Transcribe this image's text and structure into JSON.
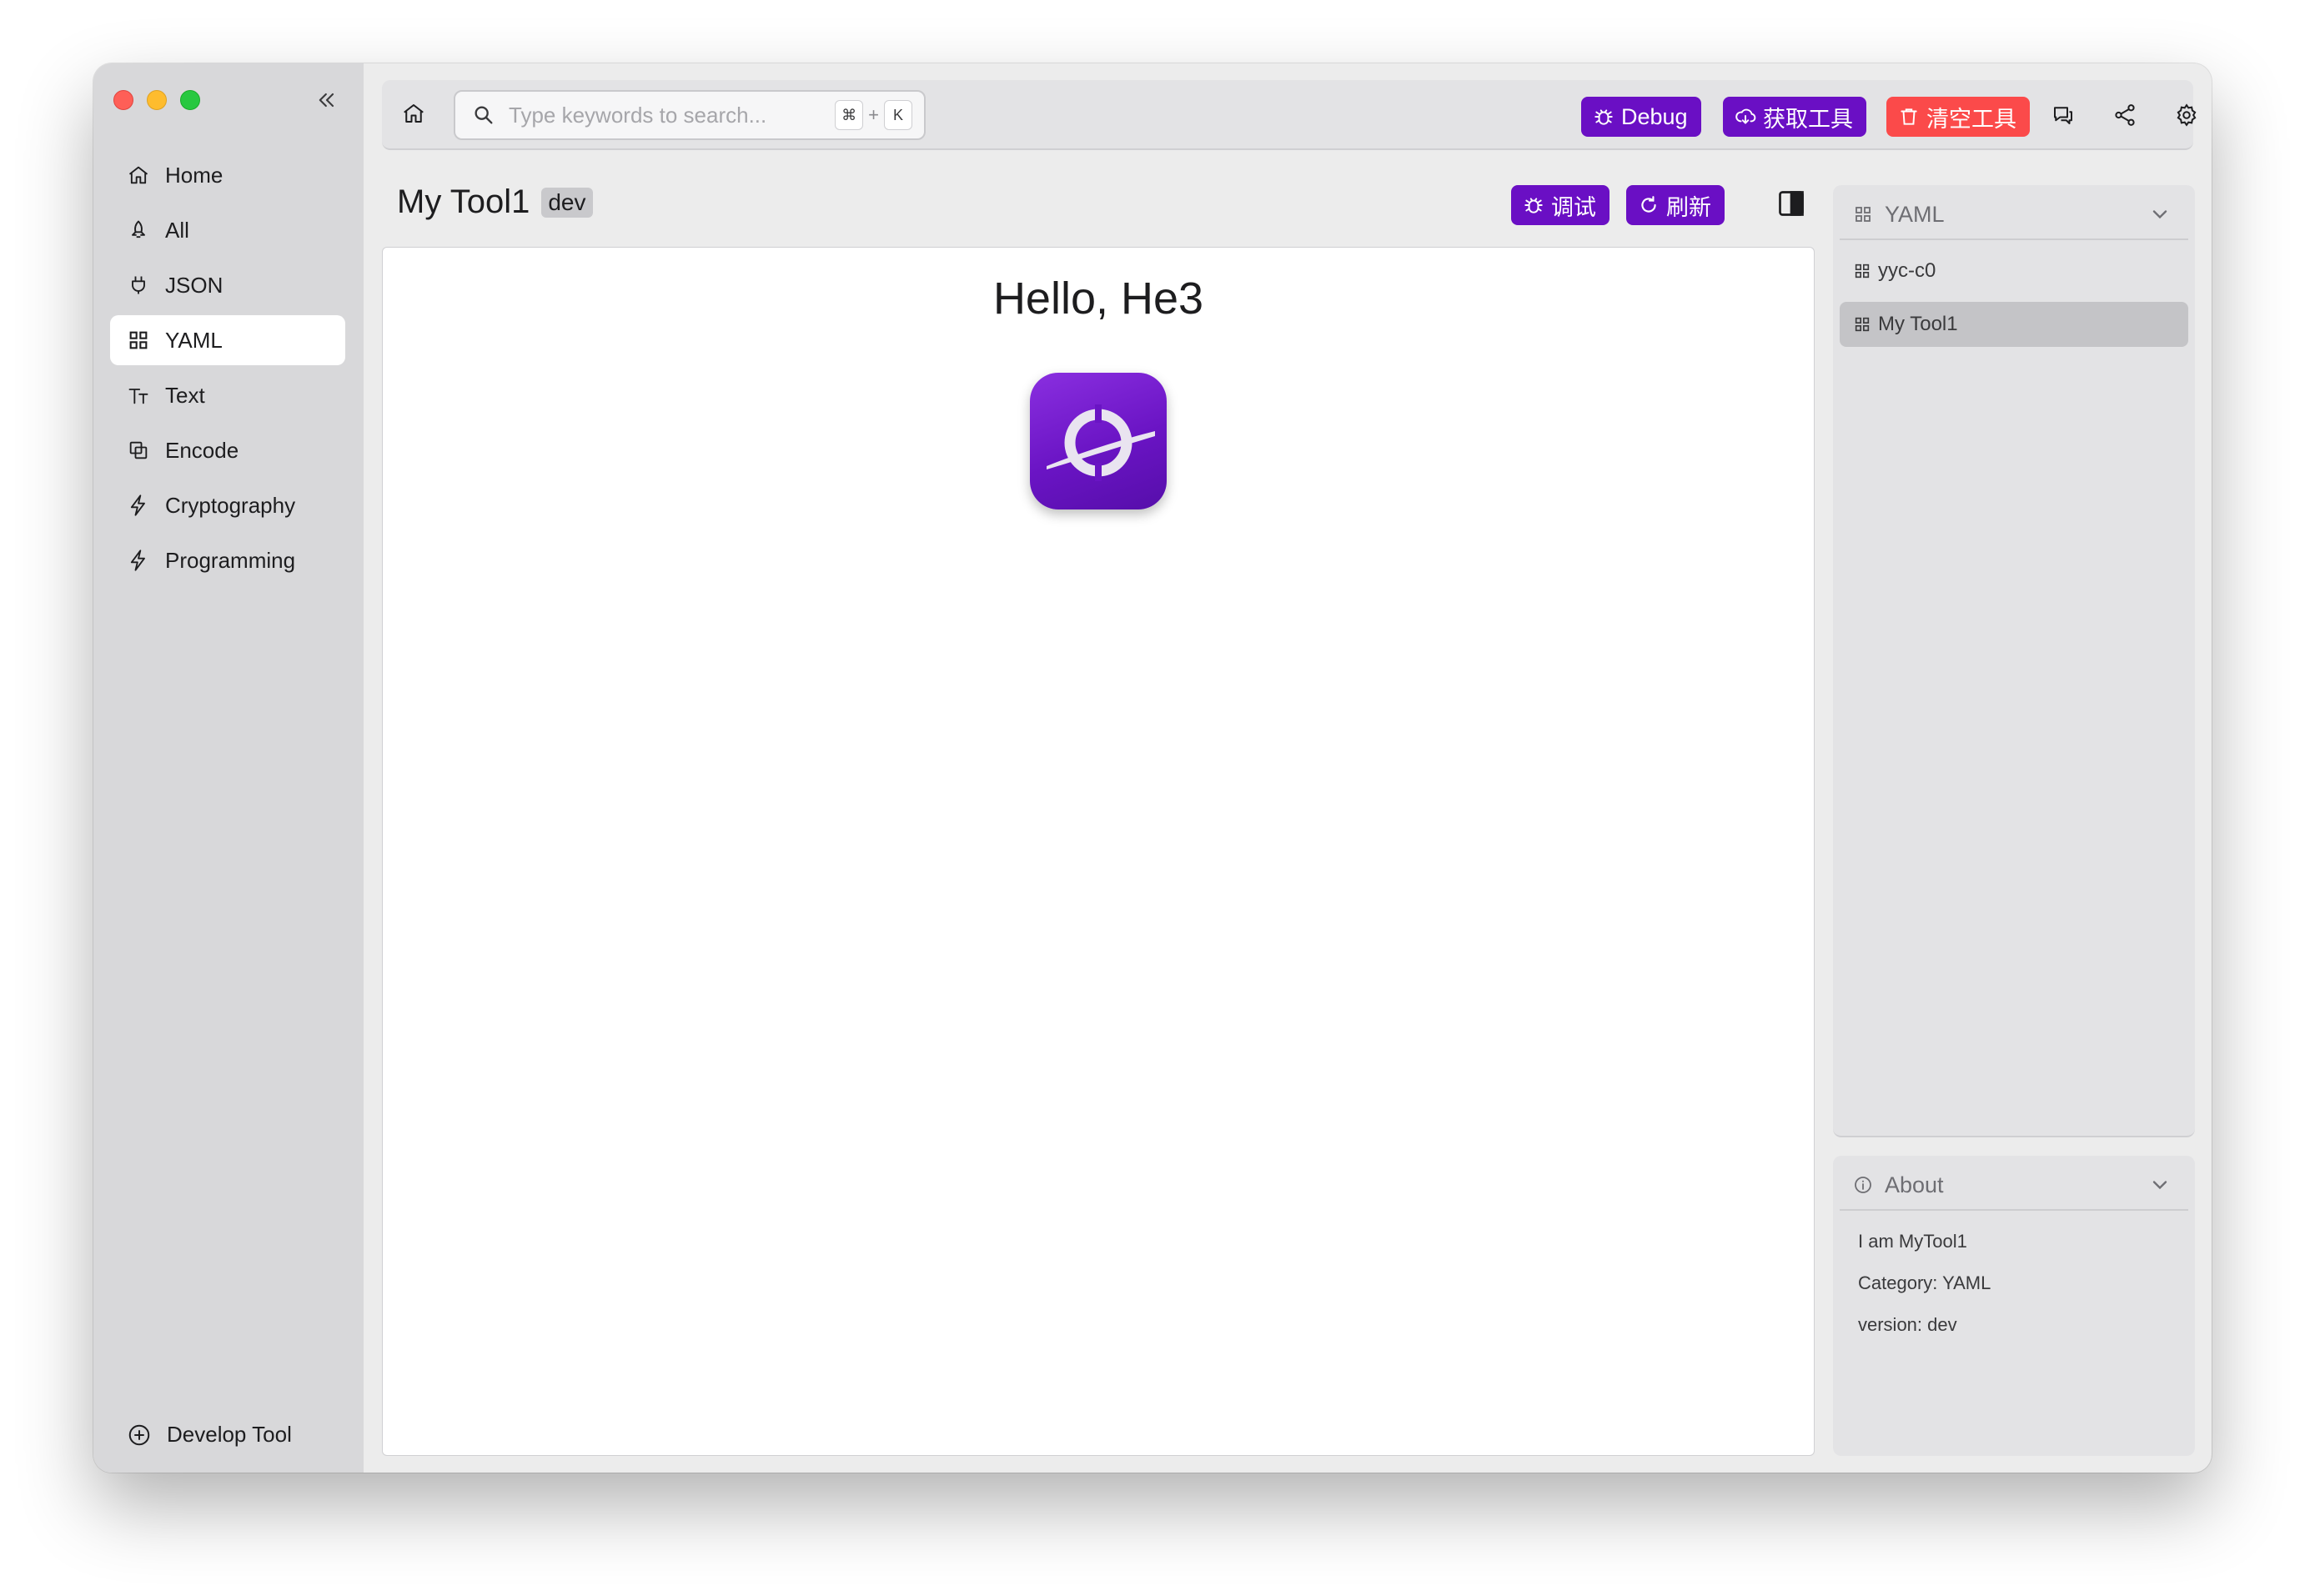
{
  "sidebar": {
    "items": [
      {
        "label": "Home",
        "icon": "home-icon",
        "active": false
      },
      {
        "label": "All",
        "icon": "rocket-icon",
        "active": false
      },
      {
        "label": "JSON",
        "icon": "plug-icon",
        "active": false
      },
      {
        "label": "YAML",
        "icon": "grid-icon",
        "active": true
      },
      {
        "label": "Text",
        "icon": "text-size-icon",
        "active": false
      },
      {
        "label": "Encode",
        "icon": "layers-icon",
        "active": false
      },
      {
        "label": "Cryptography",
        "icon": "bolt-icon",
        "active": false
      },
      {
        "label": "Programming",
        "icon": "bolt-icon",
        "active": false
      }
    ],
    "develop_label": "Develop Tool"
  },
  "toolbar": {
    "search_placeholder": "Type keywords to search...",
    "shortcut_key1": "⌘",
    "shortcut_plus": "+",
    "shortcut_key2": "K",
    "debug_label": "Debug",
    "get_tools_label": "获取工具",
    "clear_tools_label": "清空工具"
  },
  "page": {
    "title": "My Tool1",
    "badge": "dev",
    "debug_label": "调试",
    "refresh_label": "刷新"
  },
  "content": {
    "heading": "Hello, He3"
  },
  "right_panel": {
    "section_title": "YAML",
    "items": [
      {
        "label": "yyc-c0",
        "selected": false
      },
      {
        "label": "My Tool1",
        "selected": true
      }
    ]
  },
  "about": {
    "title": "About",
    "line1": "I am MyTool1",
    "line2": "Category: YAML",
    "line3": "version: dev"
  },
  "colors": {
    "accent_purple": "#6a0fc4",
    "danger_red": "#fb4a4a",
    "sidebar_bg": "#d8d8da"
  }
}
